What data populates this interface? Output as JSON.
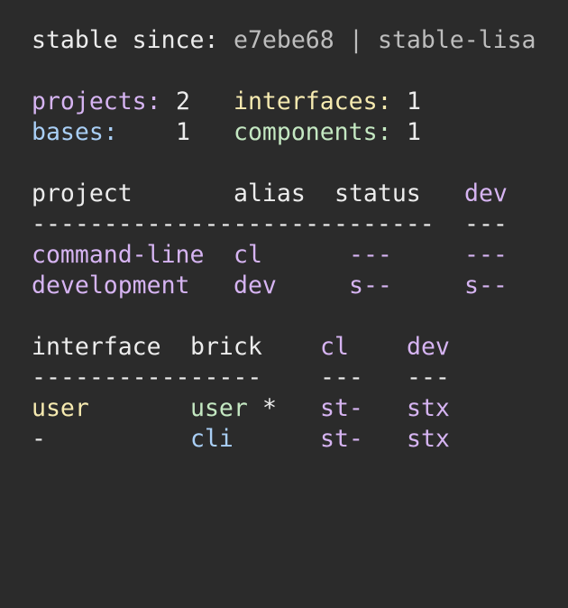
{
  "stable": {
    "label": "stable since:",
    "hash": "e7ebe68",
    "separator": "|",
    "tag": "stable-lisa"
  },
  "summary": {
    "projects_label": "projects:",
    "projects_count": "2",
    "interfaces_label": "interfaces:",
    "interfaces_count": "1",
    "bases_label": "bases:",
    "bases_count": "1",
    "components_label": "components:",
    "components_count": "1"
  },
  "projects_table": {
    "headers": [
      "project",
      "alias",
      "status",
      "dev"
    ],
    "rule_main": "----------------------------",
    "rule_dev": "---",
    "rows": [
      {
        "project": "command-line",
        "alias": "cl",
        "status": "---",
        "dev": "---"
      },
      {
        "project": "development",
        "alias": "dev",
        "status": "s--",
        "dev": "s--"
      }
    ]
  },
  "bricks_table": {
    "headers": [
      "interface",
      "brick",
      "cl",
      "dev"
    ],
    "rule_main": "----------------",
    "rule_cl": "---",
    "rule_dev": "---",
    "rows": [
      {
        "interface": "user",
        "brick": "user",
        "marker": "*",
        "cl": "st-",
        "dev": "stx"
      },
      {
        "interface": "-",
        "brick": "cli",
        "marker": "",
        "cl": "st-",
        "dev": "stx"
      }
    ]
  },
  "colors": {
    "background": "#2b2b2b",
    "text": "#ececec",
    "project": "#d6b4f2",
    "interface": "#f6eab0",
    "base": "#a9cff6",
    "component": "#c4e8c2"
  }
}
